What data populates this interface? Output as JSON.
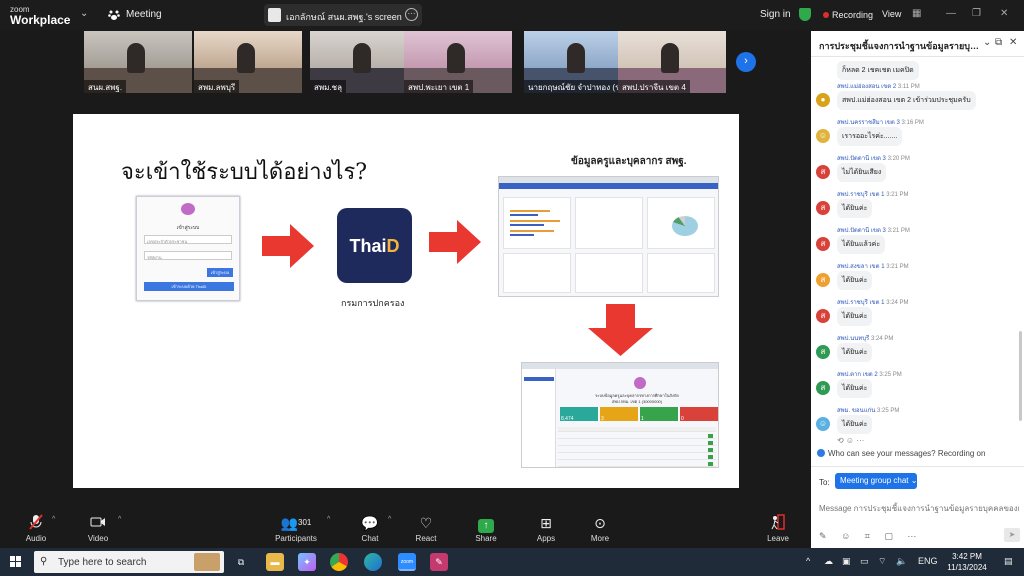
{
  "topbar": {
    "logo_line1": "zoom",
    "logo_line2": "Workplace",
    "meeting_label": "Meeting",
    "share_title": "เอกลักษณ์ สนผ.สพฐ.'s screen",
    "signin": "Sign in",
    "recording": "Recording",
    "view": "View"
  },
  "thumbnails": [
    {
      "name": "สนผ.สพฐ."
    },
    {
      "name": "สพม.ลพบุรี"
    },
    {
      "name": "สพม.ชลุ"
    },
    {
      "name": "สพป.พะเยา เขต 1"
    },
    {
      "name": "นายกฤษณ์ชัย จำปาทอง (รอ"
    },
    {
      "name": "สพป.ปราจีน เขต 4"
    }
  ],
  "slide": {
    "title": "จะเข้าใช้ระบบได้อย่างไร?",
    "subtitle": "ข้อมูลครูและบุคลากร สพฐ.",
    "login_title": "เข้าสู่ระบบ",
    "login_user": "เลขประจำตัวประชาชน",
    "login_pass": "รหัสผ่าน",
    "login_btn": "เข้าสู่ระบบ",
    "login_thaid": "เข้าระบบด้วย ThaID",
    "thaid_logo_a": "Thai",
    "thaid_logo_b": "D",
    "thaid_caption": "กรมการปกครอง",
    "dash2_title": "ระบบข้อมูลครูและบุคลากรทางการศึกษาในสังกัด",
    "dash2_sub": "สพป.กทม. เขต 1 (30000000)",
    "dash2_cards": [
      "8,474",
      "3",
      "1",
      "0"
    ]
  },
  "chat": {
    "title": "การประชุมชี้แจงการนำฐานข้อมูลรายบุคคลของเด็กนักเรียน",
    "messages": [
      {
        "who": "",
        "time": "",
        "text": "ก็หลด 2 เชคเชด เมคปิด",
        "avatar_color": "#cccccc",
        "avatar_letter": ""
      },
      {
        "who": "สพป.แม่ฮ่องสอน เขต 2",
        "time": "3:11 PM",
        "text": "สพป.แม่ฮ่องสอน เขต 2 เข้าร่วมประชุมครับ",
        "avatar_color": "#d9a319",
        "avatar_letter": "●"
      },
      {
        "who": "สพป.นครราชสีมา เขต 3",
        "time": "3:16 PM",
        "text": "เรารออะไรค่ะ.......",
        "avatar_color": "#e2b33c",
        "avatar_letter": "☺"
      },
      {
        "who": "สพป.ปัตตานี เขต 3",
        "time": "3:20 PM",
        "text": "ไม่ได้ยินเสียง",
        "avatar_color": "#d9423b",
        "avatar_letter": "ส"
      },
      {
        "who": "สพป.ราชบุรี เขต 1",
        "time": "3:21 PM",
        "text": "ได้ยินค่ะ",
        "avatar_color": "#d9423b",
        "avatar_letter": "ส"
      },
      {
        "who": "สพป.ปัตตานี เขต 3",
        "time": "3:21 PM",
        "text": "ได้ยินแล้วค่ะ",
        "avatar_color": "#d9423b",
        "avatar_letter": "ส"
      },
      {
        "who": "สพป.สงขลา เขต 1",
        "time": "3:21 PM",
        "text": "ได้ยินค่ะ",
        "avatar_color": "#f0a030",
        "avatar_letter": "ส"
      },
      {
        "who": "สพป.ราชบุรี เขต 1",
        "time": "3:24 PM",
        "text": "ได้ยินค่ะ",
        "avatar_color": "#d9423b",
        "avatar_letter": "ส"
      },
      {
        "who": "สพป.นนทบุรี",
        "time": "3:24 PM",
        "text": "ได้ยินค่ะ",
        "avatar_color": "#2e9a52",
        "avatar_letter": "ส"
      },
      {
        "who": "สพป.ตาก เขต 2",
        "time": "3:25 PM",
        "text": "ได้ยินค่ะ",
        "avatar_color": "#2e9a52",
        "avatar_letter": "ส"
      },
      {
        "who": "สพม. ขอนแก่น",
        "time": "3:25 PM",
        "text": "ได้ยินค่ะ",
        "avatar_color": "#5ab0e0",
        "avatar_letter": "☺"
      }
    ],
    "notice": "Who can see your messages? Recording on",
    "to_label": "To:",
    "to_value": "Meeting group chat ⌄",
    "input_placeholder": "Message การประชุมชี้แจงการนำฐานข้อมูลรายบุคคลของเด็กน..."
  },
  "toolbar": {
    "audio": "Audio",
    "video": "Video",
    "participants": "Participants",
    "participants_count": "301",
    "chat": "Chat",
    "react": "React",
    "share": "Share",
    "apps": "Apps",
    "more": "More",
    "leave": "Leave"
  },
  "taskbar": {
    "search_placeholder": "Type here to search",
    "lang": "ENG",
    "time": "3:42 PM",
    "date": "11/13/2024"
  }
}
